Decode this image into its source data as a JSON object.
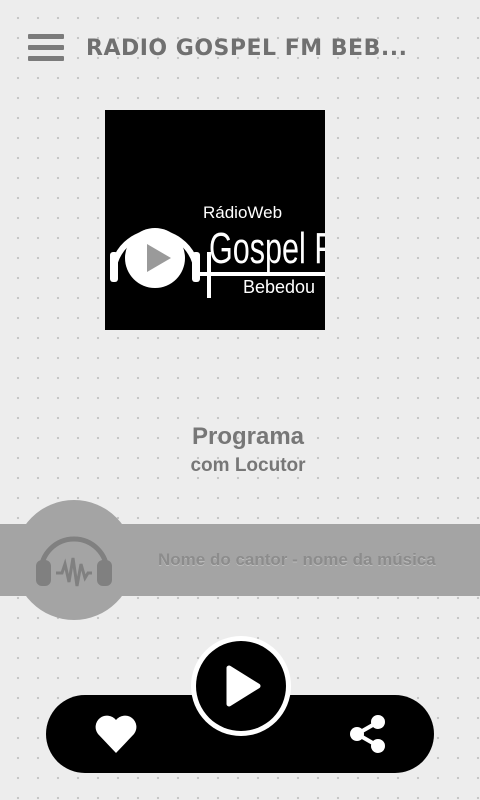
{
  "header": {
    "menu_icon": "hamburger-menu-icon",
    "title": "RADIO GOSPEL FM BEB..."
  },
  "logo": {
    "small_text": "RádioWeb",
    "big_text": "Gospel F",
    "city_text": "Bebedou"
  },
  "program": {
    "name": "Programa",
    "host": "com Locutor"
  },
  "now_playing": {
    "icon": "headphones-icon",
    "track": "Nome do cantor - nome da música"
  },
  "controls": {
    "favorite_icon": "heart-icon",
    "play_icon": "play-icon",
    "share_icon": "share-icon"
  },
  "colors": {
    "background": "#ededed",
    "bar_gray": "#a4a4a4",
    "text_gray": "#777777",
    "control_black": "#000000"
  }
}
